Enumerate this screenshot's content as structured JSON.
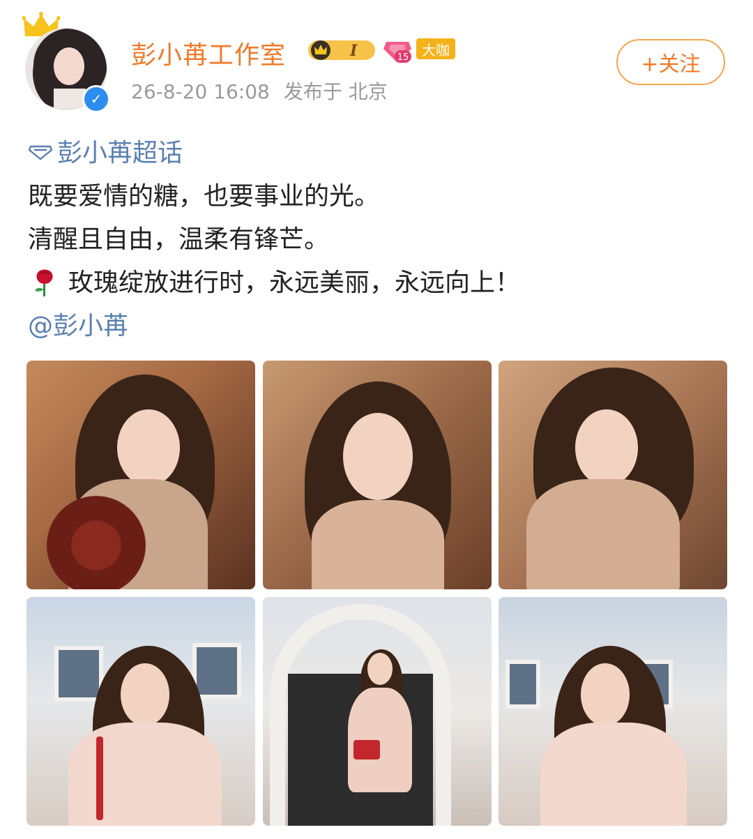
{
  "header": {
    "username": "彭小苒工作室",
    "level_badge": "I",
    "diamond_level": "15",
    "daka_badge": "大咖",
    "timestamp": "26-8-20 16:08",
    "location": "发布于 北京",
    "follow_label": "+关注"
  },
  "post": {
    "topic": "彭小苒超话",
    "lines": [
      "既要爱情的糖，也要事业的光。",
      "清醒且自由，温柔有锋芒。",
      "玫瑰绽放进行时，永远美丽，永远向上！"
    ],
    "mention": "@彭小苒"
  },
  "photos": [
    {
      "icon": "portrait-with-roses"
    },
    {
      "icon": "portrait-closeup"
    },
    {
      "icon": "portrait-hand-on-cheek"
    },
    {
      "icon": "portrait-outdoor-white-house"
    },
    {
      "icon": "full-length-archway"
    },
    {
      "icon": "portrait-outdoor-white-house"
    }
  ],
  "colors": {
    "username": "#f07a2a",
    "link": "#5a7fb0",
    "meta": "#9a9a9a",
    "follow_border": "#f5a64a"
  }
}
